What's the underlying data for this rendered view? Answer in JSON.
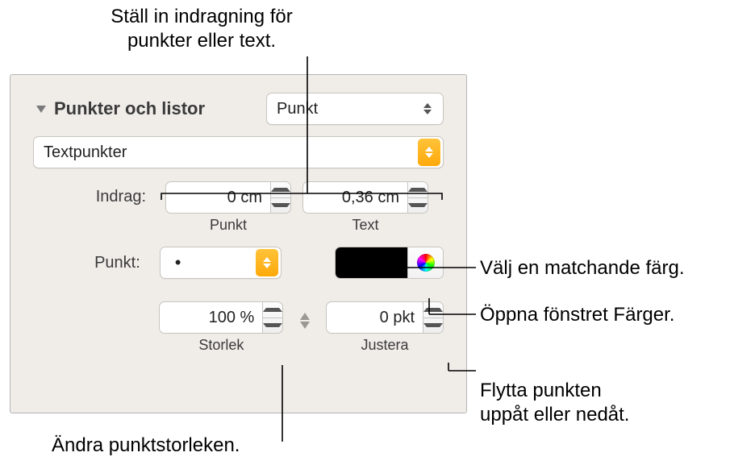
{
  "callouts": {
    "indent_top": "Ställ in indragning för\npunkter eller text.",
    "match_color": "Välj en matchande färg.",
    "open_colors": "Öppna fönstret Färger.",
    "move_bullet": "Flytta punkten\nuppåt eller nedåt.",
    "change_size": "Ändra punktstorleken."
  },
  "panel": {
    "section_title": "Punkter och listor",
    "list_type": "Punkt",
    "style_select": "Textpunkter",
    "indent": {
      "label": "Indrag:",
      "bullet_value": "0 cm",
      "bullet_caption": "Punkt",
      "text_value": "0,36 cm",
      "text_caption": "Text"
    },
    "bullet_row": {
      "label": "Punkt:",
      "glyph": "•"
    },
    "size": {
      "value": "100 %",
      "caption": "Storlek"
    },
    "align": {
      "value": "0 pkt",
      "caption": "Justera"
    }
  }
}
